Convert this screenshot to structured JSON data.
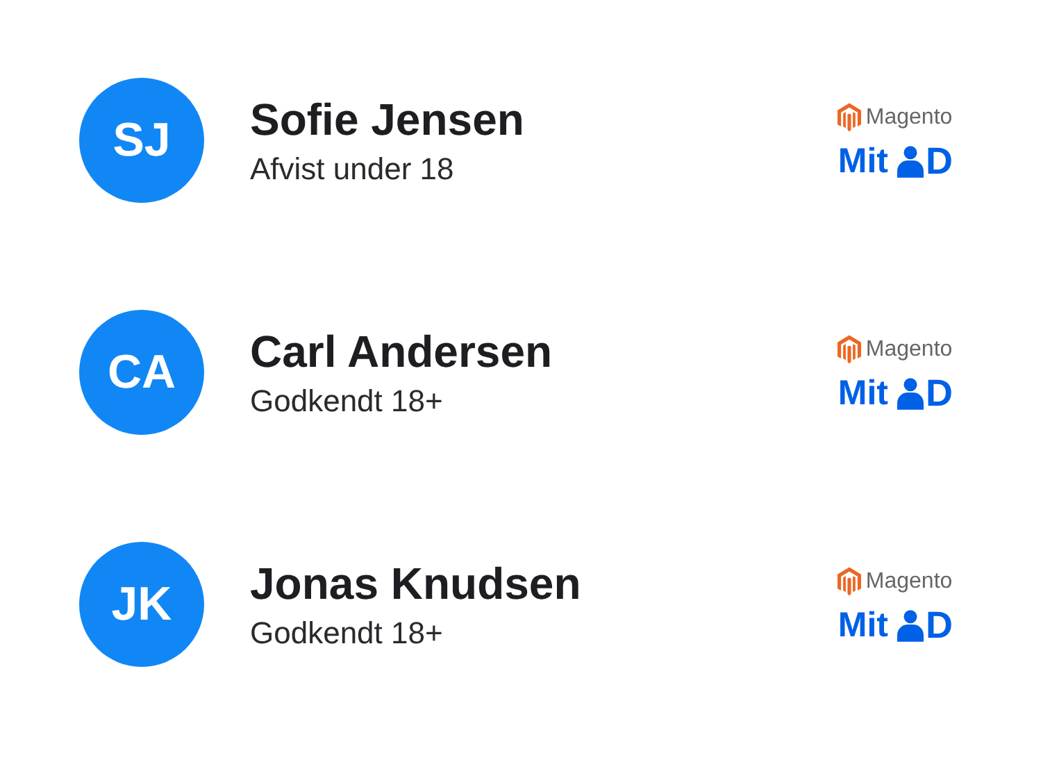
{
  "users": [
    {
      "initials": "SJ",
      "name": "Sofie Jensen",
      "status": "Afvist under 18",
      "sources": {
        "store": "Magento",
        "id_prefix": "Mit",
        "id_suffix": "D"
      }
    },
    {
      "initials": "CA",
      "name": "Carl Andersen",
      "status": "Godkendt 18+",
      "sources": {
        "store": "Magento",
        "id_prefix": "Mit",
        "id_suffix": "D"
      }
    },
    {
      "initials": "JK",
      "name": "Jonas Knudsen",
      "status": "Godkendt 18+",
      "sources": {
        "store": "Magento",
        "id_prefix": "Mit",
        "id_suffix": "D"
      }
    }
  ]
}
